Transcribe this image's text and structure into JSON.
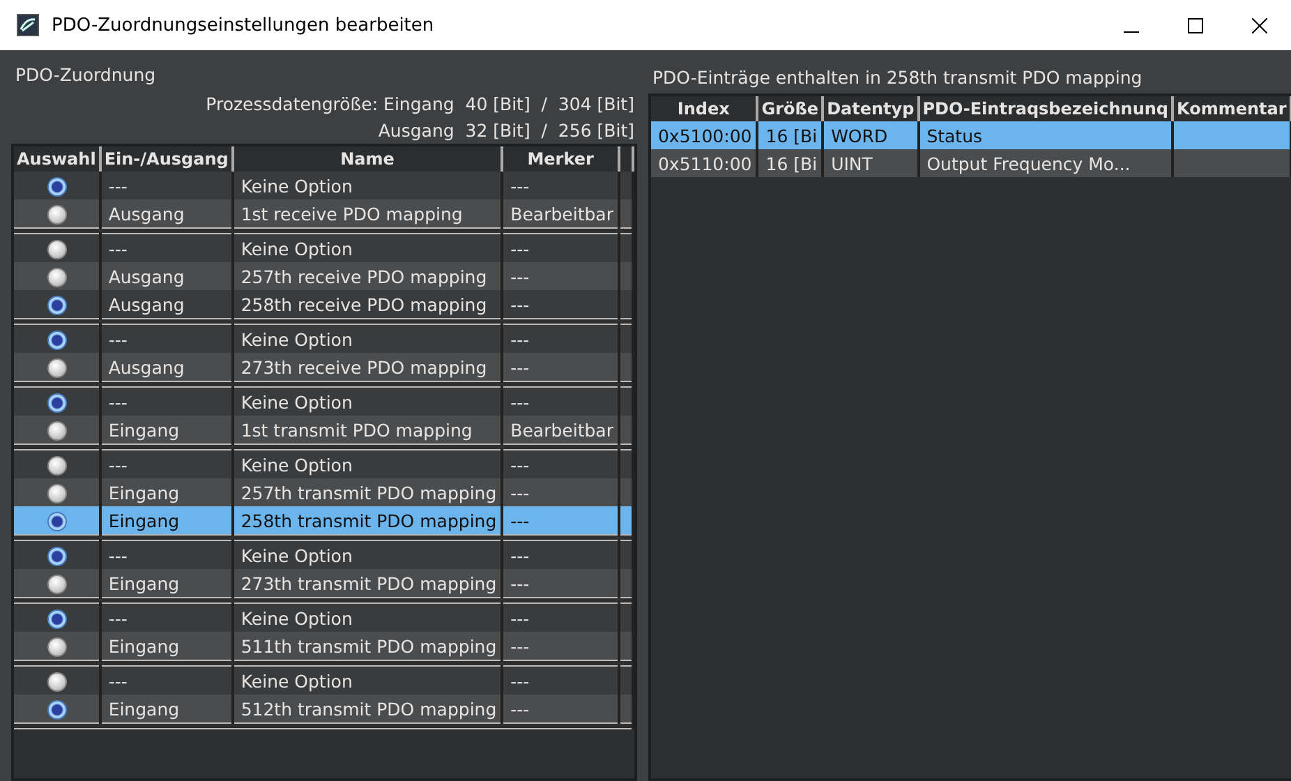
{
  "window": {
    "title": "PDO-Zuordnungseinstellungen bearbeiten"
  },
  "assignment": {
    "title": "PDO-Zuordnung",
    "summary": [
      "Prozessdatengröße: Eingang  40 [Bit]  /  304 [Bit]",
      "Ausgang  32 [Bit]  /  256 [Bit]"
    ],
    "columns": [
      "Auswahl",
      "Ein-/Ausgang",
      "Name",
      "Merker"
    ],
    "groups": [
      {
        "rows": [
          {
            "checked": true,
            "selected": false,
            "io": "---",
            "name": "Keine Option",
            "marker": "---"
          },
          {
            "checked": false,
            "selected": false,
            "io": "Ausgang",
            "name": "1st receive PDO mapping",
            "marker": "Bearbeitbar"
          }
        ]
      },
      {
        "rows": [
          {
            "checked": false,
            "selected": false,
            "io": "---",
            "name": "Keine Option",
            "marker": "---"
          },
          {
            "checked": false,
            "selected": false,
            "io": "Ausgang",
            "name": "257th receive PDO mapping",
            "marker": "---"
          },
          {
            "checked": true,
            "selected": false,
            "io": "Ausgang",
            "name": "258th receive PDO mapping",
            "marker": "---"
          }
        ]
      },
      {
        "rows": [
          {
            "checked": true,
            "selected": false,
            "io": "---",
            "name": "Keine Option",
            "marker": "---"
          },
          {
            "checked": false,
            "selected": false,
            "io": "Ausgang",
            "name": "273th receive PDO mapping",
            "marker": "---"
          }
        ]
      },
      {
        "rows": [
          {
            "checked": true,
            "selected": false,
            "io": "---",
            "name": "Keine Option",
            "marker": "---"
          },
          {
            "checked": false,
            "selected": false,
            "io": "Eingang",
            "name": "1st transmit PDO mapping",
            "marker": "Bearbeitbar"
          }
        ]
      },
      {
        "rows": [
          {
            "checked": false,
            "selected": false,
            "io": "---",
            "name": "Keine Option",
            "marker": "---"
          },
          {
            "checked": false,
            "selected": false,
            "io": "Eingang",
            "name": "257th transmit PDO mapping",
            "marker": "---"
          },
          {
            "checked": true,
            "selected": true,
            "io": "Eingang",
            "name": "258th transmit PDO mapping",
            "marker": "---"
          }
        ]
      },
      {
        "rows": [
          {
            "checked": true,
            "selected": false,
            "io": "---",
            "name": "Keine Option",
            "marker": "---"
          },
          {
            "checked": false,
            "selected": false,
            "io": "Eingang",
            "name": "273th transmit PDO mapping",
            "marker": "---"
          }
        ]
      },
      {
        "rows": [
          {
            "checked": true,
            "selected": false,
            "io": "---",
            "name": "Keine Option",
            "marker": "---"
          },
          {
            "checked": false,
            "selected": false,
            "io": "Eingang",
            "name": "511th transmit PDO mapping",
            "marker": "---"
          }
        ]
      },
      {
        "rows": [
          {
            "checked": false,
            "selected": false,
            "io": "---",
            "name": "Keine Option",
            "marker": "---"
          },
          {
            "checked": true,
            "selected": false,
            "io": "Eingang",
            "name": "512th transmit PDO mapping",
            "marker": "---"
          }
        ]
      }
    ]
  },
  "entries": {
    "title": "PDO-Einträge enthalten in 258th transmit PDO mapping",
    "columns": [
      "Index",
      "Größe",
      "Datentyp",
      "PDO-Eintraqsbezeichnunq",
      "Kommentar"
    ],
    "rows": [
      {
        "selected": true,
        "cells": [
          "0x5100:00",
          "16 [Bi",
          "WORD",
          "Status",
          ""
        ]
      },
      {
        "selected": false,
        "cells": [
          "0x5110:00",
          "16 [Bi",
          "UINT",
          "Output Frequency Mo...",
          ""
        ]
      }
    ]
  }
}
